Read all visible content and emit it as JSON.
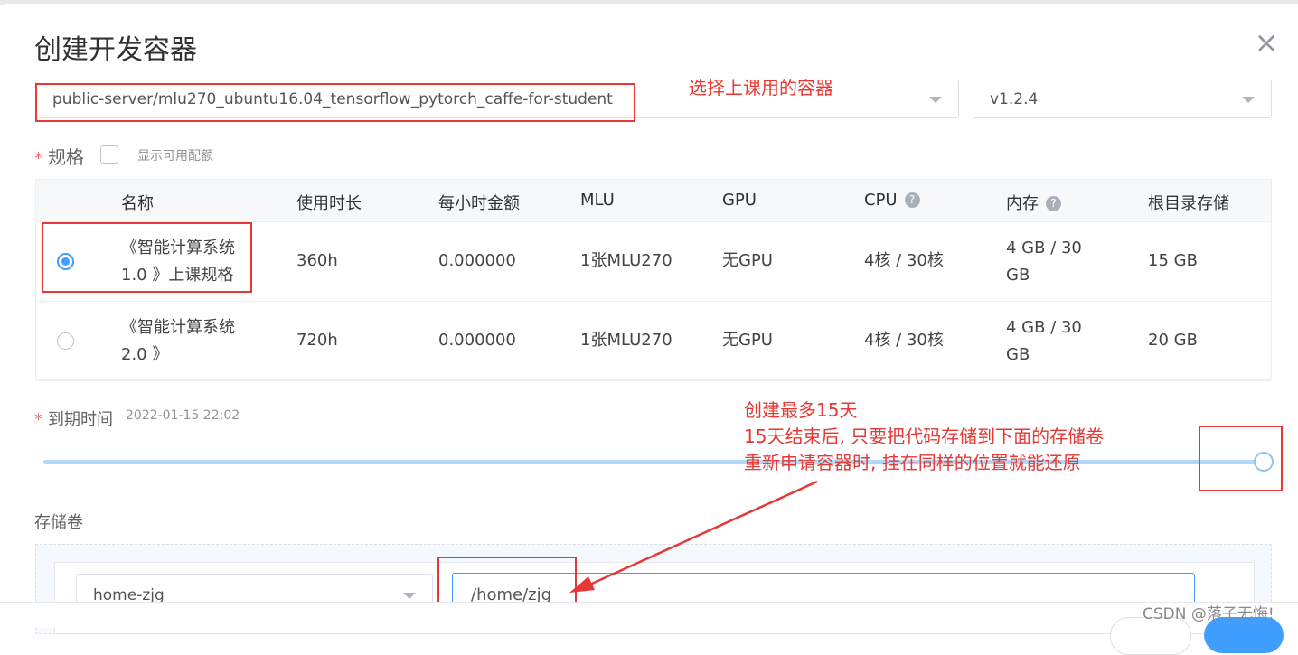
{
  "dialog": {
    "title": "创建开发容器",
    "close_icon": "×"
  },
  "image": {
    "repo_value": "public-server/mlu270_ubuntu16.04_tensorflow_pytorch_caffe-for-student",
    "version_value": "v1.2.4"
  },
  "spec": {
    "label": "规格",
    "required_mark": "*",
    "show_available_label": "显示可用配额"
  },
  "table": {
    "headers": [
      "名称",
      "使用时长",
      "每小时金额",
      "MLU",
      "GPU",
      "CPU",
      "内存",
      "根目录存储"
    ],
    "help_icon": "?",
    "rows": [
      {
        "selected": true,
        "name_line1": "《智能计算系统",
        "name_line2": "1.0 》上课规格",
        "duration": "360h",
        "hourly_cost": "0.000000",
        "mlu": "1张MLU270",
        "gpu": "无GPU",
        "cpu": "4核 / 30核",
        "mem_line1": "4 GB / 30",
        "mem_line2": "GB",
        "storage": "15 GB"
      },
      {
        "selected": false,
        "name_line1": "《智能计算系统",
        "name_line2": "2.0 》",
        "duration": "720h",
        "hourly_cost": "0.000000",
        "mlu": "1张MLU270",
        "gpu": "无GPU",
        "cpu": "4核 / 30核",
        "mem_line1": "4 GB / 30",
        "mem_line2": "GB",
        "storage": "20 GB"
      }
    ]
  },
  "expire": {
    "label": "到期时间",
    "required_mark": "*",
    "date": "2022-01-15 22:02",
    "slider_level": 1.0
  },
  "storage": {
    "label": "存储卷",
    "volume_value": "home-zjg",
    "mount_path_value": "/home/zjg"
  },
  "annotations": {
    "select_container": "选择上课用的容器",
    "line1": "创建最多15天",
    "line2": "15天结束后, 只要把代码存储到下面的存储卷",
    "line3": "重新申请容器时, 挂在同样的位置就能还原",
    "color": "#e53935"
  },
  "watermark": "CSDN @落子无悔!",
  "colors": {
    "primary": "#409eff",
    "required": "#f56c6c",
    "slider": "#b3d8f5"
  }
}
